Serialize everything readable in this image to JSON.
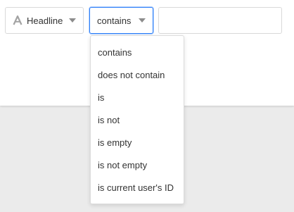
{
  "filter": {
    "field_select": {
      "label": "Headline",
      "icon": "text-a-icon"
    },
    "operator_select": {
      "label": "contains"
    },
    "value_input": {
      "value": "",
      "placeholder": ""
    }
  },
  "operator_menu": {
    "items": [
      {
        "label": "contains"
      },
      {
        "label": "does not contain"
      },
      {
        "label": "is"
      },
      {
        "label": "is not"
      },
      {
        "label": "is empty"
      },
      {
        "label": "is not empty"
      },
      {
        "label": "is current user's ID"
      }
    ]
  },
  "colors": {
    "accent_focus": "#2d7ff9",
    "panel_bg": "#ffffff",
    "page_bg": "#ebebeb",
    "border": "#d9d9d9",
    "text": "#333333",
    "icon": "#8c8c8c"
  }
}
